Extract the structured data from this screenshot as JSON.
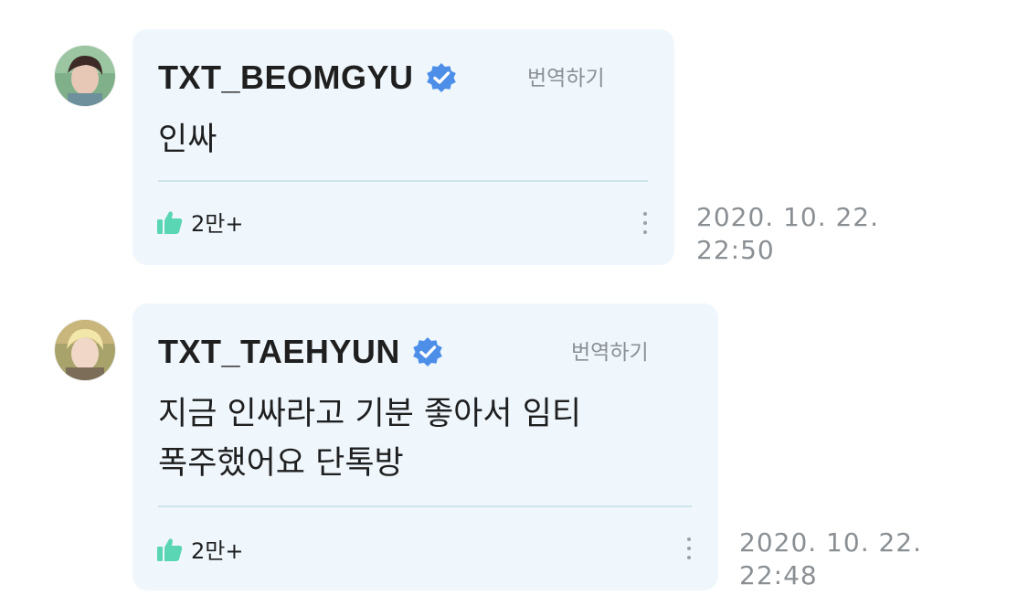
{
  "posts": [
    {
      "author": "TXT_BEOMGYU",
      "translate_label": "번역하기",
      "message": "인싸",
      "likes": "2만+",
      "date": "2020. 10. 22.",
      "time": "22:50",
      "avatar_icon": "avatar-beomgyu"
    },
    {
      "author": "TXT_TAEHYUN",
      "translate_label": "번역하기",
      "message": "지금 인싸라고 기분 좋아서 임티\n폭주했어요 단톡방",
      "likes": "2만+",
      "date": "2020. 10. 22.",
      "time": "22:48",
      "avatar_icon": "avatar-taehyun"
    }
  ],
  "colors": {
    "bubble_bg": "#eff7fd",
    "verified_blue": "#4d8fe8",
    "like_green": "#5ad6b4",
    "muted_text": "#8a8f94"
  }
}
